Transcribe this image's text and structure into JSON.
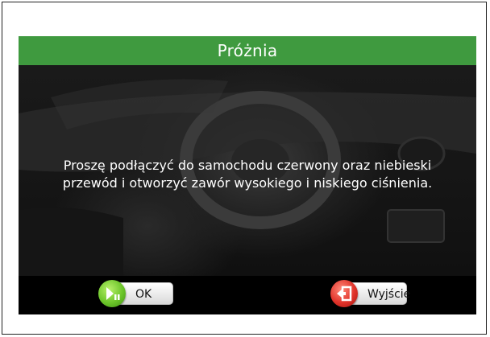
{
  "dialog": {
    "title": "Próżnia",
    "message_line1": "Proszę podłączyć do samochodu czerwony oraz niebieski",
    "message_line2": "przewód i otworzyć zawór wysokiego i niskiego ciśnienia."
  },
  "buttons": {
    "ok_label": "OK",
    "exit_label": "Wyjście"
  },
  "colors": {
    "title_bar": "#3f9a3f",
    "ok_icon": "#6cc52a",
    "exit_icon": "#e0332a"
  },
  "icons": {
    "ok": "play-pause-icon",
    "exit": "exit-door-icon"
  }
}
